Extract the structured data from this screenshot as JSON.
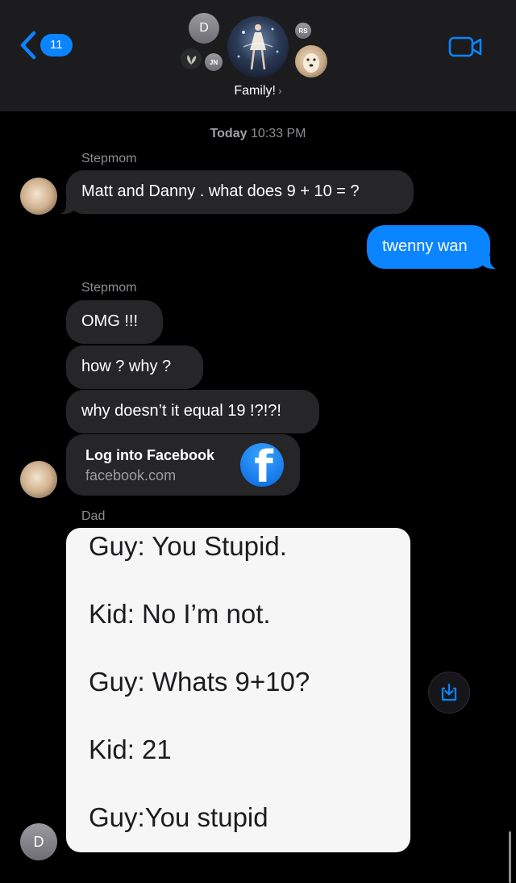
{
  "header": {
    "back_count": "11",
    "group_name": "Family!",
    "avatars": {
      "d": "D",
      "rs": "RS",
      "jn": "JN"
    }
  },
  "timestamp": {
    "day": "Today",
    "time": "10:33 PM"
  },
  "messages": {
    "sender1": "Stepmom",
    "m1": "Matt and Danny . what does  9 + 10 = ?",
    "m2": "twenny wan",
    "sender2": "Stepmom",
    "m3": "OMG !!!",
    "m4": "how ? why ?",
    "m5": "why doesn’t it equal 19 !?!?!",
    "link": {
      "title": "Log into Facebook",
      "domain": "facebook.com"
    },
    "sender3": "Dad",
    "dad_avatar": "D",
    "image_lines": [
      "Guy: You Stupid.",
      "Kid: No I’m not.",
      "Guy: Whats 9+10?",
      "Kid: 21",
      "Guy:You stupid"
    ]
  },
  "colors": {
    "accent": "#0a84ff",
    "bubble_gray": "#262628",
    "header_bg": "#1c1c1e"
  },
  "icons": [
    "chevron-left-icon",
    "video-camera-icon",
    "facebook-logo-icon",
    "save-image-icon"
  ]
}
